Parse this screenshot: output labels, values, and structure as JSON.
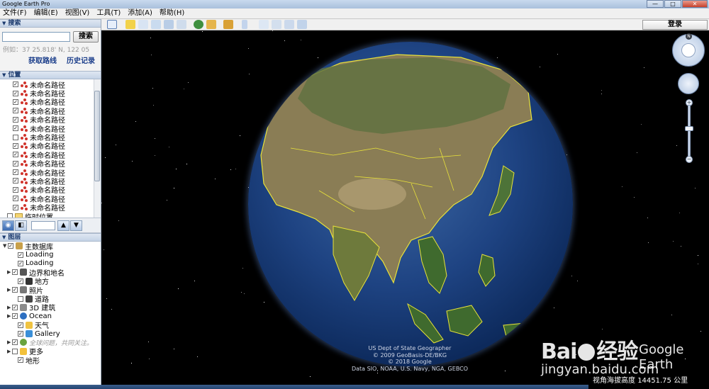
{
  "window": {
    "title": "Google Earth Pro",
    "minimize": "—",
    "maximize": "□",
    "close": "✕"
  },
  "menu": [
    "文件(F)",
    "编辑(E)",
    "视图(V)",
    "工具(T)",
    "添加(A)",
    "帮助(H)"
  ],
  "search": {
    "header": "搜索",
    "button": "搜索",
    "hint": "例如：37 25.818' N, 122 05",
    "directions": "获取路线",
    "history": "历史记录"
  },
  "places": {
    "header": "位置",
    "items": [
      {
        "label": "未命名路径",
        "checked": true
      },
      {
        "label": "未命名路径",
        "checked": true
      },
      {
        "label": "未命名路径",
        "checked": true
      },
      {
        "label": "未命名路径",
        "checked": true
      },
      {
        "label": "未命名路径",
        "checked": true
      },
      {
        "label": "未命名路径",
        "checked": true
      },
      {
        "label": "未命名路径",
        "checked": false
      },
      {
        "label": "未命名路径",
        "checked": true
      },
      {
        "label": "未命名路径",
        "checked": true
      },
      {
        "label": "未命名路径",
        "checked": true
      },
      {
        "label": "未命名路径",
        "checked": true
      },
      {
        "label": "未命名路径",
        "checked": true
      },
      {
        "label": "未命名路径",
        "checked": true
      },
      {
        "label": "未命名路径",
        "checked": true
      },
      {
        "label": "未命名路径",
        "checked": true
      }
    ],
    "temp_folder": "临时位置"
  },
  "layers": {
    "header": "图层",
    "items": [
      {
        "label": "主数据库",
        "type": "db"
      },
      {
        "label": "Loading",
        "type": "loading"
      },
      {
        "label": "Loading",
        "type": "loading"
      },
      {
        "label": "边界和地名",
        "type": "borders"
      },
      {
        "label": "地方",
        "type": "places"
      },
      {
        "label": "照片",
        "type": "photos"
      },
      {
        "label": "道路",
        "type": "roads"
      },
      {
        "label": "3D 建筑",
        "type": "buildings"
      },
      {
        "label": "Ocean",
        "type": "ocean"
      },
      {
        "label": "天气",
        "type": "weather"
      },
      {
        "label": "Gallery",
        "type": "gallery"
      },
      {
        "label": "全球问题，共同关注。",
        "type": "awareness"
      },
      {
        "label": "更多",
        "type": "more"
      },
      {
        "label": "地形",
        "type": "terrain"
      }
    ]
  },
  "toolbar": {
    "login": "登录"
  },
  "map": {
    "attribution": [
      "US Dept of State Geographer",
      "© 2009 GeoBasis-DE/BKG",
      "© 2018 Google",
      "Data SIO, NOAA, U.S. Navy, NGA, GEBCO"
    ],
    "altitude_label": "视角海拔高度",
    "altitude_value": "14451.75",
    "altitude_unit": "公里",
    "compass_north": "N"
  },
  "watermark": {
    "brand_left": "Bai",
    "brand_right": "经验",
    "product": "Google Earth",
    "url": "jingyan.baidu.com"
  },
  "colors": {
    "ocean": "#1e4382",
    "border": "#e8e23a",
    "land_green": "#3f6a2e",
    "land_dry": "#9c8a5c"
  }
}
